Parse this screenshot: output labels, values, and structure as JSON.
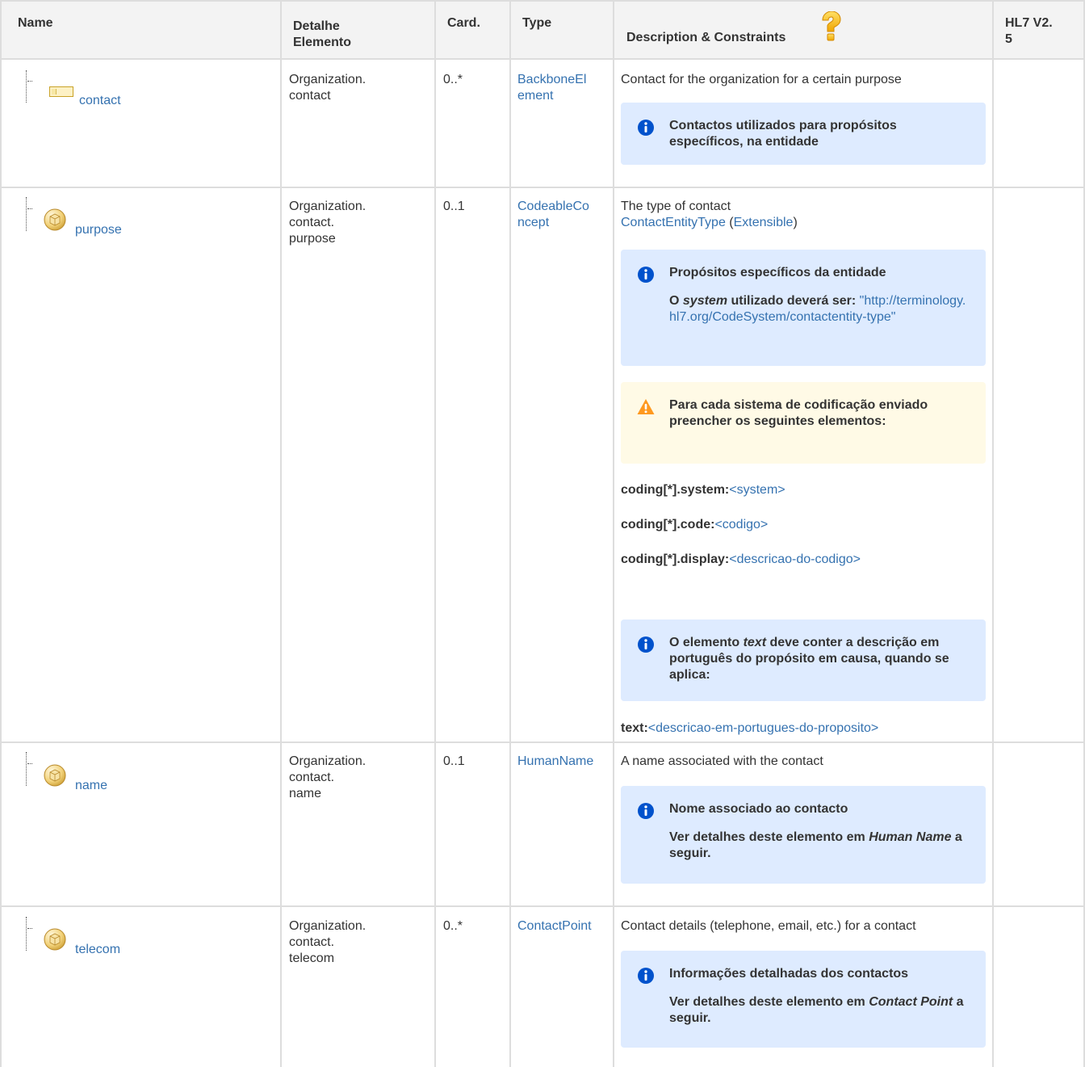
{
  "header": {
    "name": "Name",
    "detalhe_line1": "Detalhe",
    "detalhe_line2": "Elemento",
    "card": "Card.",
    "type": "Type",
    "description": "Description & Constraints",
    "hl7_line1": "HL7 V2.",
    "hl7_line2": "5"
  },
  "rows": [
    {
      "name": "contact",
      "icon": "element-icon",
      "path": [
        "Organization.",
        "contact"
      ],
      "card": "0..*",
      "type": [
        "BackboneEl",
        "ement"
      ],
      "description": "Contact for the organization for a certain purpose",
      "info1": "Contactos utilizados para propósitos específicos, na entidade"
    },
    {
      "name": "purpose",
      "icon": "datatype-cube-icon",
      "path": [
        "Organization.",
        "contact.",
        "purpose"
      ],
      "card": "0..1",
      "type": [
        "CodeableCo",
        "ncept"
      ],
      "description": "The type of contact",
      "binding_name": "ContactEntityType",
      "binding_open": " (",
      "binding_strength": "Extensible",
      "binding_close": ")",
      "info_title": "Propósitos específicos da entidade",
      "info_sys_pre": "O ",
      "info_sys_em": "system",
      "info_sys_post": " utilizado deverá ser: ",
      "info_sys_link": "\"http://terminology.hl7.org/CodeSystem/contactentity-type\"",
      "warn_text": "Para cada sistema de codificação enviado preencher os seguintes elementos:",
      "kv": [
        {
          "key": "coding[*].system:",
          "value": "<system>"
        },
        {
          "key": "coding[*].code:",
          "value": "<codigo>"
        },
        {
          "key": "coding[*].display:",
          "value": "<descricao-do-codigo>"
        }
      ],
      "info2_pre": "O elemento ",
      "info2_em": "text",
      "info2_post": " deve conter a descrição em português do propósito em causa, quando se aplica:",
      "text_key": "text:",
      "text_value": "<descricao-em-portugues-do-proposito>"
    },
    {
      "name": "name",
      "icon": "datatype-cube-icon",
      "path": [
        "Organization.",
        "contact.",
        "name"
      ],
      "card": "0..1",
      "type": [
        "HumanName"
      ],
      "description": "A name associated with the contact",
      "info_title": "Nome associado ao contacto",
      "info_detail_pre": "Ver detalhes deste elemento em ",
      "info_detail_em": "Human Name",
      "info_detail_post": " a seguir."
    },
    {
      "name": "telecom",
      "icon": "datatype-cube-icon",
      "path": [
        "Organization.",
        "contact.",
        "telecom"
      ],
      "card": "0..*",
      "type": [
        "ContactPoint"
      ],
      "description": "Contact details (telephone, email, etc.) for a contact",
      "info_title": "Informações detalhadas dos contactos",
      "info_detail_pre": "Ver detalhes deste elemento em ",
      "info_detail_em": "Contact Point",
      "info_detail_post": " a seguir."
    }
  ],
  "colors": {
    "link": "#3572b0",
    "info_bg": "#deebff",
    "warn_bg": "#fffae6",
    "info_icon": "#0052cc",
    "warn_icon": "#ff991f",
    "border": "#dddddd",
    "header_bg": "#f3f3f3"
  }
}
